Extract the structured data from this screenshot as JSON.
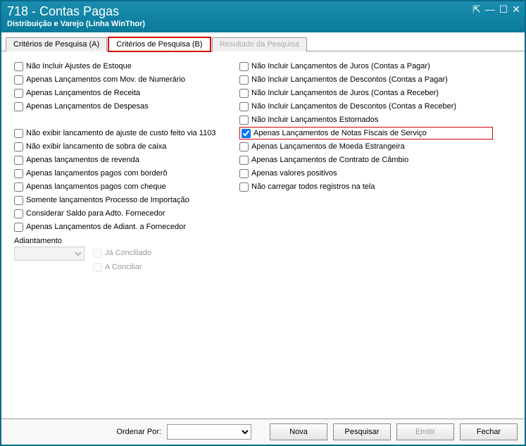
{
  "window": {
    "title": "718 - Contas Pagas",
    "subtitle": "Distribuição e Varejo (Linha WinThor)"
  },
  "tabs": {
    "a": "Critérios de Pesquisa (A)",
    "b": "Critérios de Pesquisa (B)",
    "result": "Resultado da Pesquisa"
  },
  "left": {
    "c0": "Não Incluir Ajustes de Estoque",
    "c1": "Apenas Lançamentos com Mov. de Numerário",
    "c2": "Apenas Lançamentos de Receita",
    "c3": "Apenas Lançamentos de Despesas",
    "c4": "Não exibir lancamento de ajuste de custo feito via 1103",
    "c5": "Não exibir lancamento de sobra de caixa",
    "c6": "Apenas lançamentos de revenda",
    "c7": "Apenas lançamentos pagos com borderô",
    "c8": "Apenas lançamentos pagos com cheque",
    "c9": "Somente lançamentos Processo de Importação",
    "c10": "Considerar Saldo para Adto. Fornecedor",
    "c11": "Apenas Lançamentos de Adiant. a Fornecedor",
    "adiantamento_label": "Adiantamento",
    "ja_conciliado": "Já Conciliado",
    "a_conciliar": "A Conciliar"
  },
  "right": {
    "c0": "Não Incluir Lançamentos de Juros (Contas a Pagar)",
    "c1": "Não Incluir Lançamentos de Descontos (Contas a Pagar)",
    "c2": "Não Incluir Lançamentos de Juros (Contas a Receber)",
    "c3": "Não Incluir Lançamentos de Descontos (Contas a Receber)",
    "c4": "Não Incluir Lançamentos Estornados",
    "c5": "Apenas Lançamentos de Notas Fiscais de Serviço",
    "c6": "Apenas Lançamentos de Moeda Estrangeira",
    "c7": "Apenas Lançamentos de Contrato de Câmbio",
    "c8": "Apenas valores positivos",
    "c9": "Não carregar todos registros na tela"
  },
  "footer": {
    "ordenar_por": "Ordenar Por:",
    "nova": "Nova",
    "pesquisar": "Pesquisar",
    "emitir": "Emitir",
    "fechar": "Fechar"
  }
}
